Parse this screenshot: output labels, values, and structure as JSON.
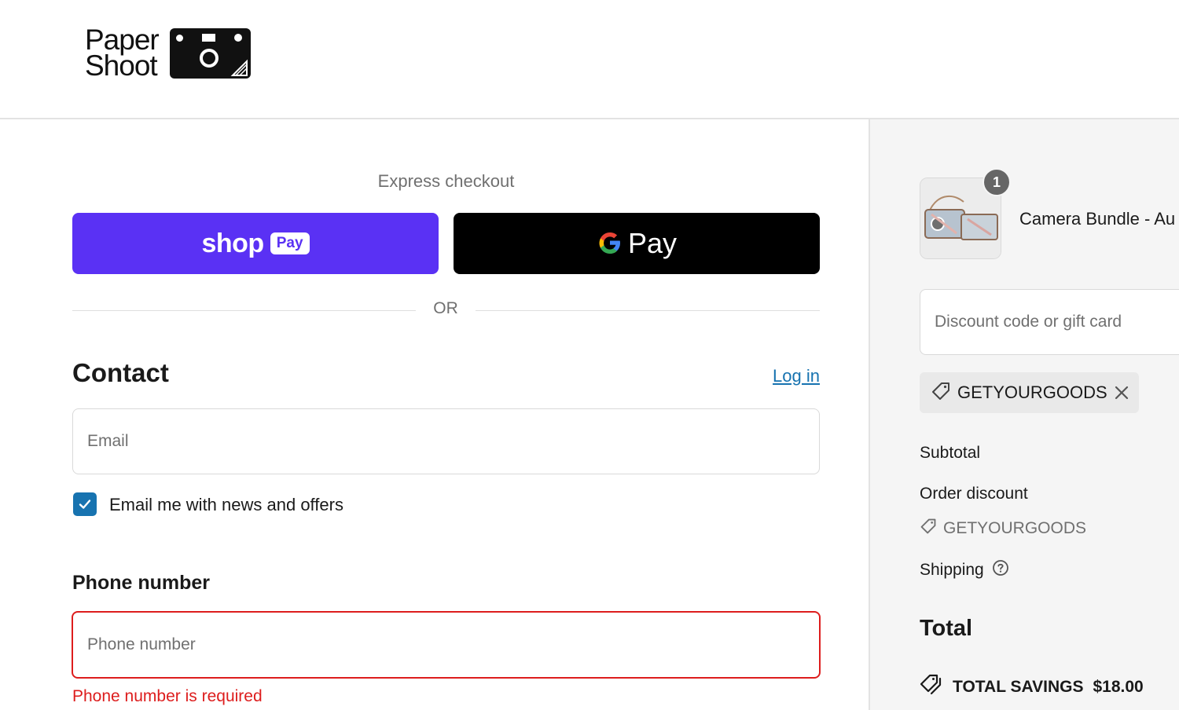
{
  "brand": {
    "logo_line1": "Paper",
    "logo_line2": "Shoot"
  },
  "express": {
    "label": "Express checkout",
    "shop_pay_word": "shop",
    "shop_pay_pill": "Pay",
    "gpay_word": "Pay",
    "or_label": "OR"
  },
  "contact": {
    "heading": "Contact",
    "login_link": "Log in",
    "email_placeholder": "Email",
    "news_checkbox_label": "Email me with news and offers",
    "news_checked": true
  },
  "phone": {
    "heading": "Phone number",
    "placeholder": "Phone number",
    "error": "Phone number is required"
  },
  "summary": {
    "item_qty": "1",
    "item_name": "Camera Bundle - Au",
    "discount_placeholder": "Discount code or gift card",
    "applied_code": "GETYOURGOODS",
    "subtotal_label": "Subtotal",
    "order_discount_label": "Order discount",
    "order_discount_code": "GETYOURGOODS",
    "shipping_label": "Shipping",
    "total_label": "Total",
    "savings_label": "TOTAL SAVINGS",
    "savings_amount": "$18.00"
  },
  "colors": {
    "shop_pay": "#5a31f4",
    "link": "#1773b0",
    "error": "#dd1d1d",
    "checkbox": "#1773b0"
  },
  "icons": [
    "camera-logo-icon",
    "google-g-icon",
    "checkmark-icon",
    "tag-icon",
    "close-icon",
    "help-circle-icon",
    "savings-tag-icon"
  ]
}
